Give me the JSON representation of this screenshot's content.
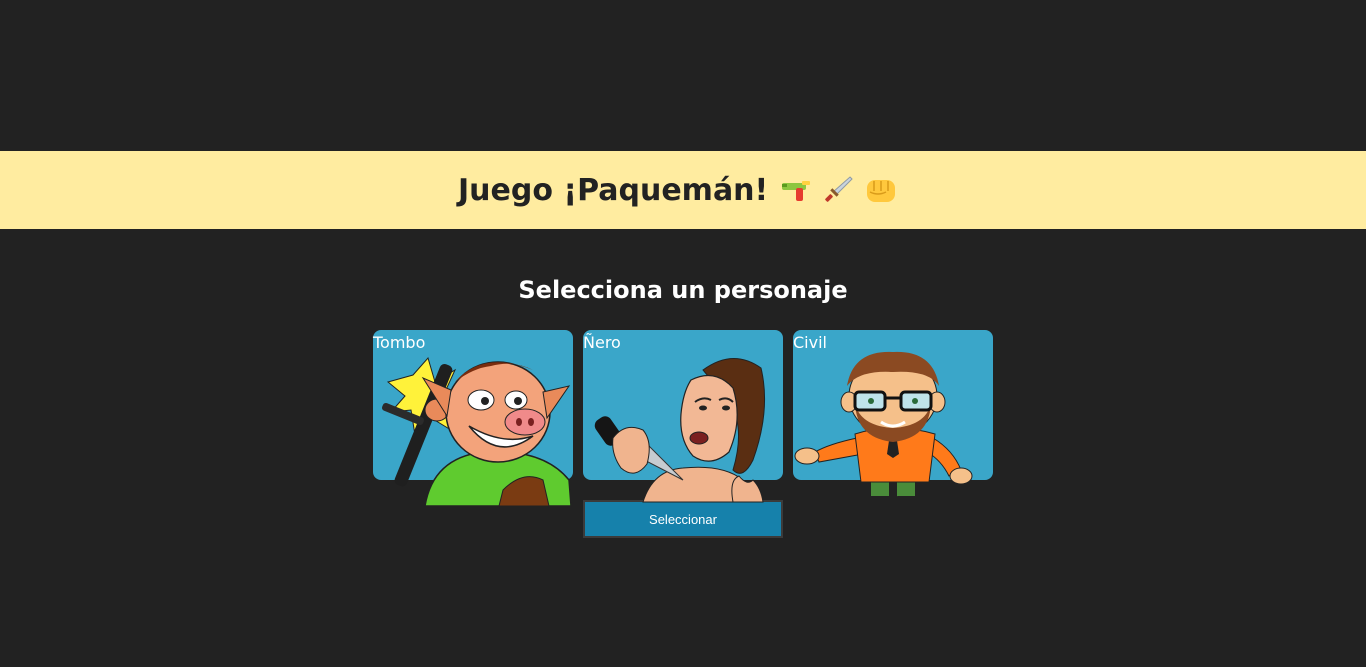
{
  "header": {
    "title": "Juego ¡Paquemán!",
    "icons": [
      "water-pistol-icon",
      "dagger-icon",
      "fist-icon"
    ],
    "background_color": "#ffeca0"
  },
  "main": {
    "subtitle": "Selecciona un personaje",
    "characters": [
      {
        "label": "Tombo",
        "art": "pig-policeman-with-baton"
      },
      {
        "label": "Ñero",
        "art": "man-with-knife"
      },
      {
        "label": "Civil",
        "art": "bearded-man-with-glasses"
      }
    ],
    "select_button": "Seleccionar"
  },
  "colors": {
    "page_background": "#222222",
    "card_background": "#3aa6c9",
    "button_background": "#1681ab"
  }
}
